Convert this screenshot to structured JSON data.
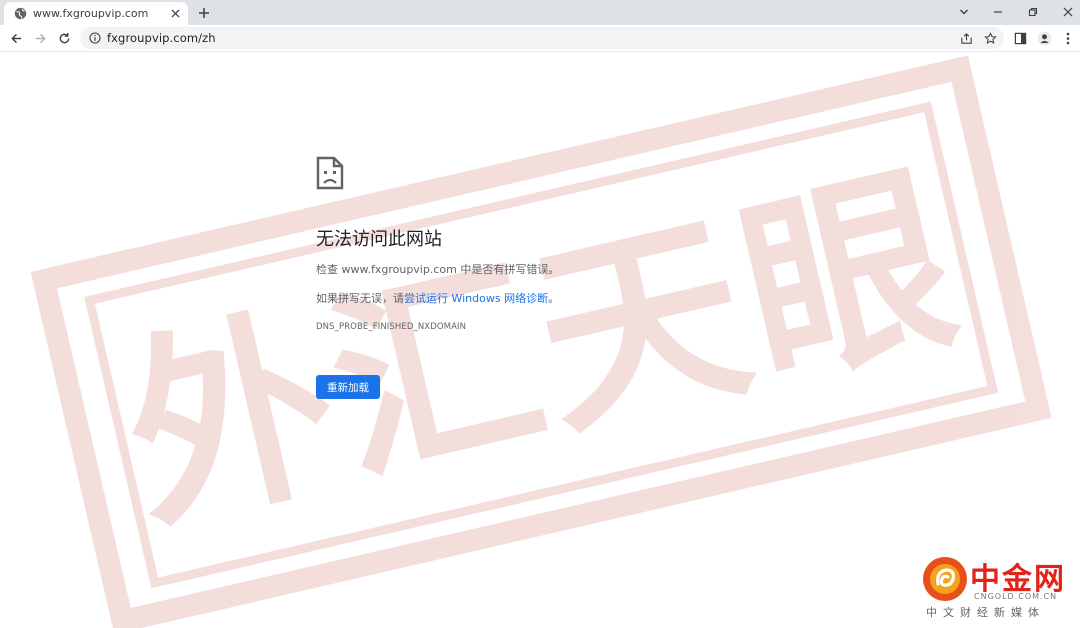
{
  "browser": {
    "tab": {
      "title": "www.fxgroupvip.com",
      "favicon": "globe-icon"
    },
    "new_tab_icon": "plus-icon",
    "window_controls": [
      "chevron-down-icon",
      "minimize-icon",
      "restore-icon",
      "close-icon"
    ],
    "address_bar": {
      "url": "fxgroupvip.com/zh",
      "security_icon": "info-icon"
    }
  },
  "error_page": {
    "icon": "sad-document-icon",
    "title": "无法访问此网站",
    "line1": "检查 www.fxgroupvip.com 中是否有拼写错误。",
    "line2_prefix": "如果拼写无误，请",
    "line2_link": "尝试运行 Windows 网络诊断",
    "line2_suffix": "。",
    "error_code": "DNS_PROBE_FINISHED_NXDOMAIN",
    "reload_label": "重新加载"
  },
  "watermark": {
    "text": "外汇天眼",
    "color": "#c0392b"
  },
  "logo": {
    "name": "中金网",
    "domain": "CNGOLD.COM.CN",
    "tagline": "中文财经新媒体",
    "color": "#e2231a"
  },
  "colors": {
    "accent": "#1a73e8",
    "tabstrip": "#dee1e6",
    "omnibox": "#f1f3f4"
  }
}
